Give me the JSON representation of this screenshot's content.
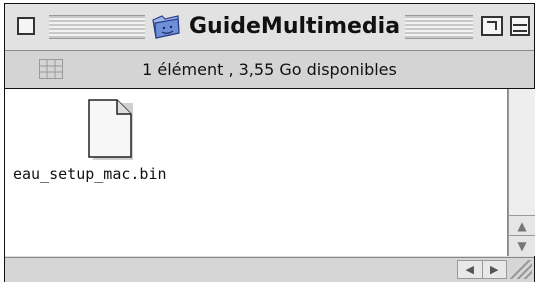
{
  "window": {
    "title": "GuideMultimedia",
    "title_icon": "folder-icon"
  },
  "infobar": {
    "status": "1 élément , 3,55 Go disponibles",
    "view_icon": "grid-view-icon"
  },
  "content": {
    "items": [
      {
        "label": "eau_setup_mac.bin",
        "icon": "document-icon"
      }
    ]
  },
  "scrollbar": {
    "up": "▲",
    "down": "▼",
    "left": "◀",
    "right": "▶"
  }
}
